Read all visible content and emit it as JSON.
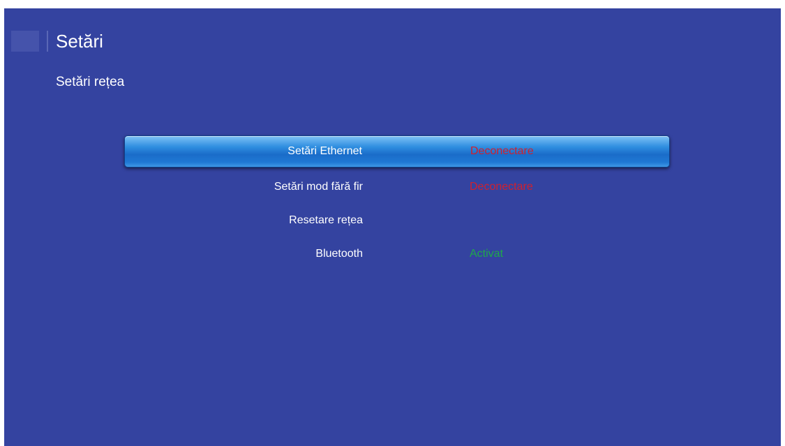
{
  "header": {
    "title": "Setări"
  },
  "section": {
    "title": "Setări rețea"
  },
  "menu": {
    "items": [
      {
        "label": "Setări Ethernet",
        "value": "Deconectare",
        "selected": true,
        "value_color": "#d0202e"
      },
      {
        "label": "Setări mod fără fir",
        "value": "Deconectare",
        "selected": false,
        "value_color": "#d0202e"
      },
      {
        "label": "Resetare rețea",
        "value": "",
        "selected": false,
        "value_color": ""
      },
      {
        "label": "Bluetooth",
        "value": "Activat",
        "selected": false,
        "value_color": "#20a84a"
      }
    ]
  },
  "colors": {
    "background": "#3443a0",
    "highlight": "#2f8ee0",
    "status_off": "#d0202e",
    "status_on": "#20a84a"
  }
}
